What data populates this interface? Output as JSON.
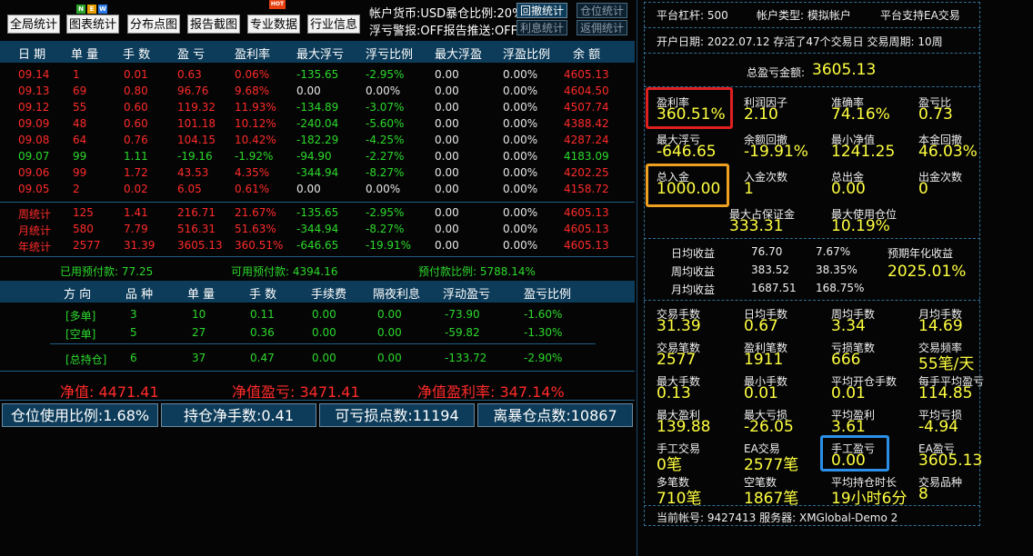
{
  "toolbar": {
    "btn1": "全局统计",
    "btn2": "图表统计",
    "btn3": "分布点图",
    "btn4": "报告截图",
    "btn5": "专业数据",
    "btn6": "行业信息",
    "badge_n": "N",
    "badge_e": "E",
    "badge_w": "W",
    "badge_hot": "HOT",
    "info1": "帐户货币:USD暴仓比例:20%",
    "info2": "浮亏警报:OFF报告推送:OFF",
    "btn_rollback": "回撤统计",
    "btn_position": "仓位统计",
    "btn_interest": "利息统计",
    "btn_commission": "返佣统计"
  },
  "daily_table": {
    "headers": [
      "日 期",
      "单 量",
      "手 数",
      "盈 亏",
      "盈利率",
      "最大浮亏",
      "浮亏比例",
      "最大浮盈",
      "浮盈比例",
      "余 额"
    ],
    "rows": [
      [
        "09.14",
        "1",
        "0.01",
        "0.63",
        "0.06%",
        "-135.65",
        "-2.95%",
        "0.00",
        "0.00%",
        "4605.13"
      ],
      [
        "09.13",
        "69",
        "0.80",
        "96.76",
        "9.68%",
        "0.00",
        "0.00%",
        "0.00",
        "0.00%",
        "4604.50"
      ],
      [
        "09.12",
        "55",
        "0.60",
        "119.32",
        "11.93%",
        "-134.89",
        "-3.07%",
        "0.00",
        "0.00%",
        "4507.74"
      ],
      [
        "09.09",
        "48",
        "0.60",
        "101.18",
        "10.12%",
        "-240.04",
        "-5.60%",
        "0.00",
        "0.00%",
        "4388.42"
      ],
      [
        "09.08",
        "64",
        "0.76",
        "104.15",
        "10.42%",
        "-182.29",
        "-4.25%",
        "0.00",
        "0.00%",
        "4287.24"
      ],
      [
        "09.07",
        "99",
        "1.11",
        "-19.16",
        "-1.92%",
        "-94.90",
        "-2.27%",
        "0.00",
        "0.00%",
        "4183.09"
      ],
      [
        "09.06",
        "99",
        "1.72",
        "43.53",
        "4.35%",
        "-344.94",
        "-8.27%",
        "0.00",
        "0.00%",
        "4202.25"
      ],
      [
        "09.05",
        "2",
        "0.02",
        "6.05",
        "0.61%",
        "0.00",
        "0.00%",
        "0.00",
        "0.00%",
        "4158.72"
      ]
    ],
    "summary": [
      [
        "周统计",
        "125",
        "1.41",
        "216.71",
        "21.67%",
        "-135.65",
        "-2.95%",
        "0.00",
        "0.00%",
        "4605.13"
      ],
      [
        "月统计",
        "580",
        "7.79",
        "516.31",
        "51.63%",
        "-344.94",
        "-8.27%",
        "0.00",
        "0.00%",
        "4605.13"
      ],
      [
        "年统计",
        "2577",
        "31.39",
        "3605.13",
        "360.51%",
        "-646.65",
        "-19.91%",
        "0.00",
        "0.00%",
        "4605.13"
      ]
    ]
  },
  "prepay": {
    "used": "已用预付款: 77.25",
    "available": "可用预付款: 4394.16",
    "ratio": "预付款比例: 5788.14%"
  },
  "position_table": {
    "headers": [
      "方 向",
      "品 种",
      "单 量",
      "手 数",
      "手续费",
      "隔夜利息",
      "浮动盈亏",
      "盈亏比例"
    ],
    "rows": [
      [
        "[多单]",
        "3",
        "10",
        "0.11",
        "0.00",
        "0.00",
        "-73.90",
        "-1.60%"
      ],
      [
        "[空单]",
        "5",
        "27",
        "0.36",
        "0.00",
        "0.00",
        "-59.82",
        "-1.30%"
      ],
      [
        "[总持仓]",
        "6",
        "37",
        "0.47",
        "0.00",
        "0.00",
        "-133.72",
        "-2.90%"
      ]
    ]
  },
  "netvalue": {
    "nav": "净值: 4471.41",
    "nav_pl": "净值盈亏: 3471.41",
    "nav_rate": "净值盈利率: 347.14%"
  },
  "bottom": {
    "b1": "仓位使用比例:1.68%",
    "b2": "持仓净手数:0.41",
    "b3": "可亏损点数:11194",
    "b4": "离暴仓点数:10867"
  },
  "right": {
    "leverage": "平台杠杆: 500",
    "acct_type": "帐户类型: 模拟帐户",
    "ea": "平台支持EA交易",
    "open_date": "开户日期: 2022.07.12 存活了47个交易日 交易周期: 10周",
    "total_pl_label": "总盈亏金额:",
    "total_pl_value": "3605.13",
    "cells": [
      [
        "盈利率",
        "360.51%"
      ],
      [
        "利润因子",
        "2.10"
      ],
      [
        "准确率",
        "74.16%"
      ],
      [
        "盈亏比",
        "0.73"
      ],
      [
        "最大浮亏",
        "-646.65"
      ],
      [
        "余额回撤",
        "-19.91%"
      ],
      [
        "最小净值",
        "1241.25"
      ],
      [
        "本金回撤",
        "46.03%"
      ],
      [
        "总入金",
        "1000.00"
      ],
      [
        "入金次数",
        "1"
      ],
      [
        "总出金",
        "0.00"
      ],
      [
        "出金次数",
        "0"
      ],
      [
        "最大占保证金",
        "333.31"
      ],
      [
        "最大使用仓位",
        "10.19%"
      ]
    ],
    "avg": {
      "day_label": "日均收益",
      "day_val": "76.70",
      "day_pct": "7.67%",
      "week_label": "周均收益",
      "week_val": "383.52",
      "week_pct": "38.35%",
      "month_label": "月均收益",
      "month_val": "1687.51",
      "month_pct": "168.75%",
      "annual_label": "预期年化收益",
      "annual_val": "2025.01%"
    },
    "cells2": [
      [
        "交易手数",
        "31.39"
      ],
      [
        "日均手数",
        "0.67"
      ],
      [
        "周均手数",
        "3.34"
      ],
      [
        "月均手数",
        "14.69"
      ],
      [
        "交易笔数",
        "2577"
      ],
      [
        "盈利笔数",
        "1911"
      ],
      [
        "亏损笔数",
        "666"
      ],
      [
        "交易频率",
        "55笔/天"
      ],
      [
        "最大手数",
        "0.13"
      ],
      [
        "最小手数",
        "0.01"
      ],
      [
        "平均开仓手数",
        "0.01"
      ],
      [
        "每手平均盈亏",
        "114.85"
      ],
      [
        "最大盈利",
        "139.88"
      ],
      [
        "最大亏损",
        "-26.05"
      ],
      [
        "平均盈利",
        "3.61"
      ],
      [
        "平均亏损",
        "-4.94"
      ],
      [
        "手工交易",
        "0笔"
      ],
      [
        "EA交易",
        "2577笔"
      ],
      [
        "手工盈亏",
        "0.00"
      ],
      [
        "EA盈亏",
        "3605.13"
      ],
      [
        "多笔数",
        "710笔"
      ],
      [
        "空笔数",
        "1867笔"
      ],
      [
        "平均持仓时长",
        "19小时6分"
      ],
      [
        "交易品种",
        "8"
      ]
    ],
    "account": "当前帐号: 9427413 服务器: XMGlobal-Demo 2"
  },
  "colors": {
    "header_bg": "#0d3c5a",
    "red": "#ff2a2a",
    "green": "#2cd92c",
    "yellow": "#ffff40",
    "box_red": "#e02020",
    "box_orange": "#f0a020",
    "box_blue": "#2b8fe8"
  }
}
